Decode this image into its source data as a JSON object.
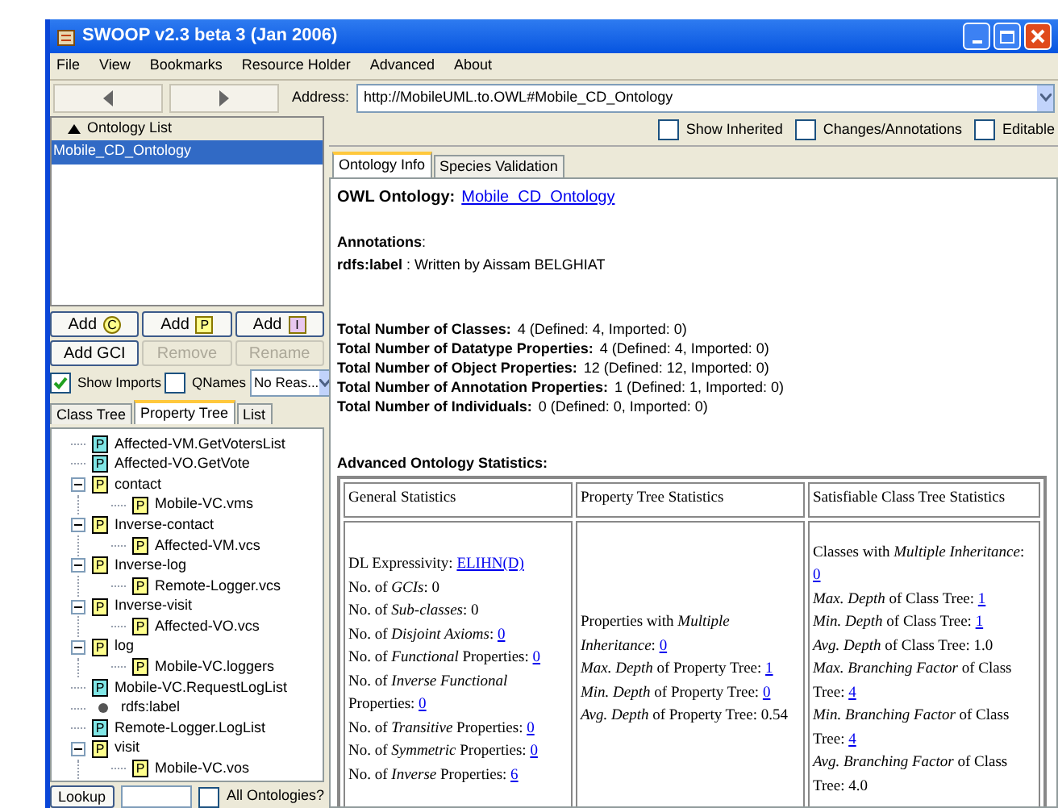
{
  "window": {
    "title": "SWOOP v2.3 beta 3 (Jan 2006)"
  },
  "menu": [
    "File",
    "View",
    "Bookmarks",
    "Resource Holder",
    "Advanced",
    "About"
  ],
  "address": {
    "label": "Address:",
    "value": "http://MobileUML.to.OWL#Mobile_CD_Ontology"
  },
  "ontology_list": {
    "title": "Ontology List",
    "items": [
      {
        "label": "Mobile_CD_Ontology",
        "selected": true
      }
    ]
  },
  "buttons": [
    {
      "label": "Add",
      "badge": "C",
      "kind": "class",
      "disabled": false
    },
    {
      "label": "Add",
      "badge": "P",
      "kind": "property",
      "disabled": false
    },
    {
      "label": "Add",
      "badge": "I",
      "kind": "individual",
      "disabled": false
    },
    {
      "label": "Add GCI",
      "disabled": false
    },
    {
      "label": "Remove",
      "disabled": true
    },
    {
      "label": "Rename",
      "disabled": true
    }
  ],
  "options": [
    {
      "label": "Show Imports",
      "checked": true
    },
    {
      "label": "QNames",
      "checked": false
    }
  ],
  "reasoner": {
    "value": "No Reas..."
  },
  "left_tabs": [
    {
      "label": "Class Tree",
      "selected": false
    },
    {
      "label": "Property Tree",
      "selected": true
    },
    {
      "label": "List",
      "selected": false
    }
  ],
  "tree": [
    {
      "label": "Affected-VM.GetVotersList",
      "kind": "datatype",
      "badge": "P"
    },
    {
      "label": "Affected-VO.GetVote",
      "kind": "datatype",
      "badge": "P"
    },
    {
      "label": "contact",
      "kind": "object",
      "badge": "P",
      "expanded": true,
      "children": [
        {
          "label": "Mobile-VC.vms",
          "kind": "object",
          "badge": "P"
        }
      ]
    },
    {
      "label": "Inverse-contact",
      "kind": "object",
      "badge": "P",
      "expanded": true,
      "children": [
        {
          "label": "Affected-VM.vcs",
          "kind": "object",
          "badge": "P"
        }
      ]
    },
    {
      "label": "Inverse-log",
      "kind": "object",
      "badge": "P",
      "expanded": true,
      "children": [
        {
          "label": "Remote-Logger.vcs",
          "kind": "object",
          "badge": "P"
        }
      ]
    },
    {
      "label": "Inverse-visit",
      "kind": "object",
      "badge": "P",
      "expanded": true,
      "children": [
        {
          "label": "Affected-VO.vcs",
          "kind": "object",
          "badge": "P"
        }
      ]
    },
    {
      "label": "log",
      "kind": "object",
      "badge": "P",
      "expanded": true,
      "children": [
        {
          "label": "Mobile-VC.loggers",
          "kind": "object",
          "badge": "P"
        }
      ]
    },
    {
      "label": "Mobile-VC.RequestLogList",
      "kind": "datatype",
      "badge": "P"
    },
    {
      "label": "rdfs:label",
      "kind": "annotation"
    },
    {
      "label": "Remote-Logger.LogList",
      "kind": "datatype",
      "badge": "P"
    },
    {
      "label": "visit",
      "kind": "object",
      "badge": "P",
      "expanded": true,
      "children": [
        {
          "label": "Mobile-VC.vos",
          "kind": "object",
          "badge": "P"
        }
      ]
    }
  ],
  "lookup": {
    "button": "Lookup",
    "option": {
      "label": "All Ontologies?",
      "checked": false
    }
  },
  "right_options": [
    {
      "label": "Show Inherited",
      "checked": false
    },
    {
      "label": "Changes/Annotations",
      "checked": false
    },
    {
      "label": "Editable",
      "checked": false
    }
  ],
  "right_tabs": [
    {
      "label": "Ontology Info",
      "selected": true
    },
    {
      "label": "Species Validation",
      "selected": false
    }
  ],
  "info": {
    "ontology_label": "OWL Ontology:",
    "ontology_link": "Mobile_CD_Ontology",
    "annotations_label": "Annotations",
    "annotations_suffix": ":",
    "annotation_key": "rdfs:label",
    "annotation_value": " : Written by Aissam BELGHIAT",
    "totals": [
      {
        "label": "Total Number of Classes:",
        "value": "4 (Defined: 4, Imported: 0)"
      },
      {
        "label": "Total Number of Datatype Properties:",
        "value": "4 (Defined: 4, Imported: 0)"
      },
      {
        "label": "Total Number of Object Properties:",
        "value": "12 (Defined: 12, Imported: 0)"
      },
      {
        "label": "Total Number of Annotation Properties:",
        "value": "1 (Defined: 1, Imported: 0)"
      },
      {
        "label": "Total Number of Individuals:",
        "value": "0 (Defined: 0, Imported: 0)"
      }
    ],
    "advanced_title": "Advanced Ontology Statistics:",
    "table": {
      "columns": [
        "General Statistics",
        "Property Tree Statistics",
        "Satisfiable Class Tree Statistics"
      ],
      "cells": [
        [
          {
            "text": "DL Expressivity: ",
            "link": "ELIHN(D)"
          },
          {
            "text": "No. of *GCIs*: 0"
          },
          {
            "text": "No. of *Sub-classes*: 0"
          },
          {
            "text": "No. of *Disjoint Axioms*: ",
            "link": "0"
          },
          {
            "text": "No. of *Functional* Properties: ",
            "link": "0"
          },
          {
            "text": "No. of *Inverse Functional* Properties: ",
            "link": "0"
          },
          {
            "text": "No. of *Transitive* Properties: ",
            "link": "0"
          },
          {
            "text": "No. of *Symmetric* Properties: ",
            "link": "0"
          },
          {
            "text": "No. of *Inverse* Properties: ",
            "link": "6"
          }
        ],
        [
          {
            "text": "Properties with *Multiple Inheritance*: ",
            "link": "0"
          },
          {
            "text": "*Max. Depth* of Property Tree: ",
            "link": "1"
          },
          {
            "text": "*Min. Depth* of Property Tree: ",
            "link": "0"
          },
          {
            "text": "*Avg. Depth* of Property Tree: 0.54"
          }
        ],
        [
          {
            "text": "Classes with *Multiple Inheritance*: ",
            "link": "0"
          },
          {
            "text": "*Max. Depth* of Class Tree: ",
            "link": "1"
          },
          {
            "text": "*Min. Depth* of Class Tree: ",
            "link": "1"
          },
          {
            "text": "*Avg. Depth* of Class Tree: 1.0"
          },
          {
            "text": "*Max. Branching Factor* of Class Tree: ",
            "link": "4"
          },
          {
            "text": "*Min. Branching Factor* of Class Tree: ",
            "link": "4"
          },
          {
            "text": "*Avg. Branching Factor* of Class Tree: 4.0"
          }
        ]
      ]
    }
  }
}
